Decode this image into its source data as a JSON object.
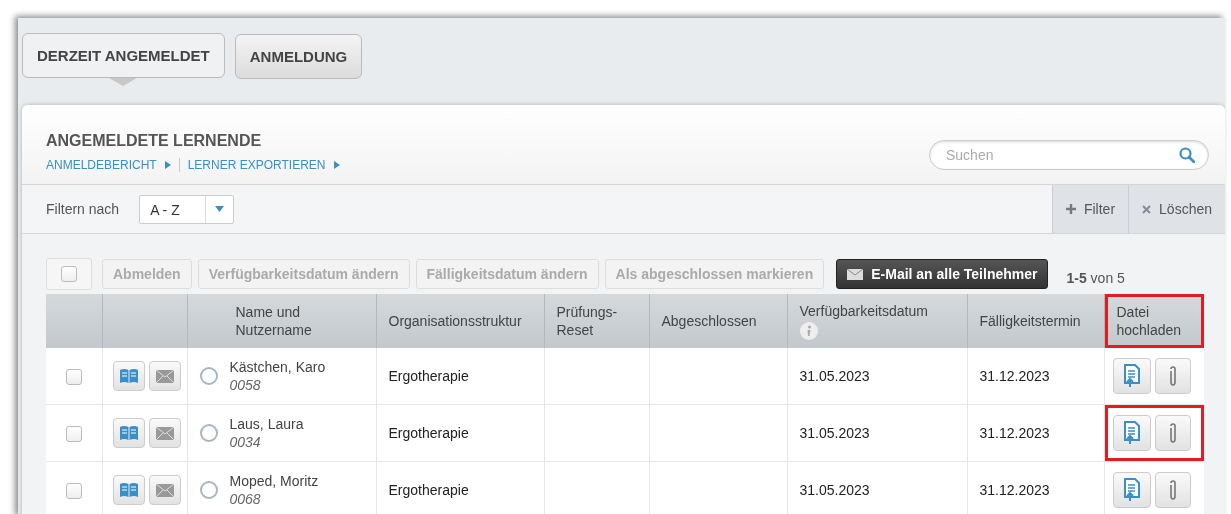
{
  "tabs": [
    {
      "label": "DERZEIT ANGEMELDET",
      "selected": true
    },
    {
      "label": "ANMELDUNG",
      "selected": false
    }
  ],
  "panel": {
    "title": "ANGEMELDETE LERNENDE",
    "links": [
      "ANMELDEBERICHT",
      "LERNER EXPORTIEREN"
    ]
  },
  "search": {
    "placeholder": "Suchen"
  },
  "filter": {
    "label": "Filtern nach",
    "value": "A - Z"
  },
  "filter_buttons": [
    {
      "label": "Filter",
      "kind": "add"
    },
    {
      "label": "Löschen",
      "kind": "clear"
    }
  ],
  "toolbar": {
    "select_all_checked": false,
    "actions": [
      {
        "label": "Abmelden",
        "disabled": true
      },
      {
        "label": "Verfügbarkeitsdatum ändern",
        "disabled": true
      },
      {
        "label": "Fälligkeitsdatum ändern",
        "disabled": true
      },
      {
        "label": "Als abgeschlossen markieren",
        "disabled": true
      },
      {
        "label": "E-Mail an alle Teilnehmer",
        "disabled": false,
        "kind": "email"
      }
    ],
    "paging": {
      "range": "1-5",
      "total": "von 5"
    }
  },
  "table": {
    "columns": [
      {
        "label": "Name und Nutzername",
        "highlighted": false
      },
      {
        "label": "Organisationsstruktur",
        "highlighted": false
      },
      {
        "label": "Prüfungs-Reset",
        "highlighted": false
      },
      {
        "label": "Abgeschlossen",
        "highlighted": false
      },
      {
        "label": "Verfügbarkeitsdatum",
        "highlighted": false,
        "info": true
      },
      {
        "label": "Fälligkeitstermin",
        "highlighted": false
      },
      {
        "label": "Datei hochladen",
        "highlighted": true
      }
    ],
    "rows": [
      {
        "checked": false,
        "selected": false,
        "name": "Kästchen, Karo",
        "username": "0058",
        "org": "Ergotherapie",
        "available": "31.05.2023",
        "due": "31.12.2023",
        "upload_highlighted": false
      },
      {
        "checked": false,
        "selected": false,
        "name": "Laus, Laura",
        "username": "0034",
        "org": "Ergotherapie",
        "available": "31.05.2023",
        "due": "31.12.2023",
        "upload_highlighted": true
      },
      {
        "checked": false,
        "selected": false,
        "name": "Moped, Moritz",
        "username": "0068",
        "org": "Ergotherapie",
        "available": "31.05.2023",
        "due": "31.12.2023",
        "upload_highlighted": false
      }
    ]
  }
}
